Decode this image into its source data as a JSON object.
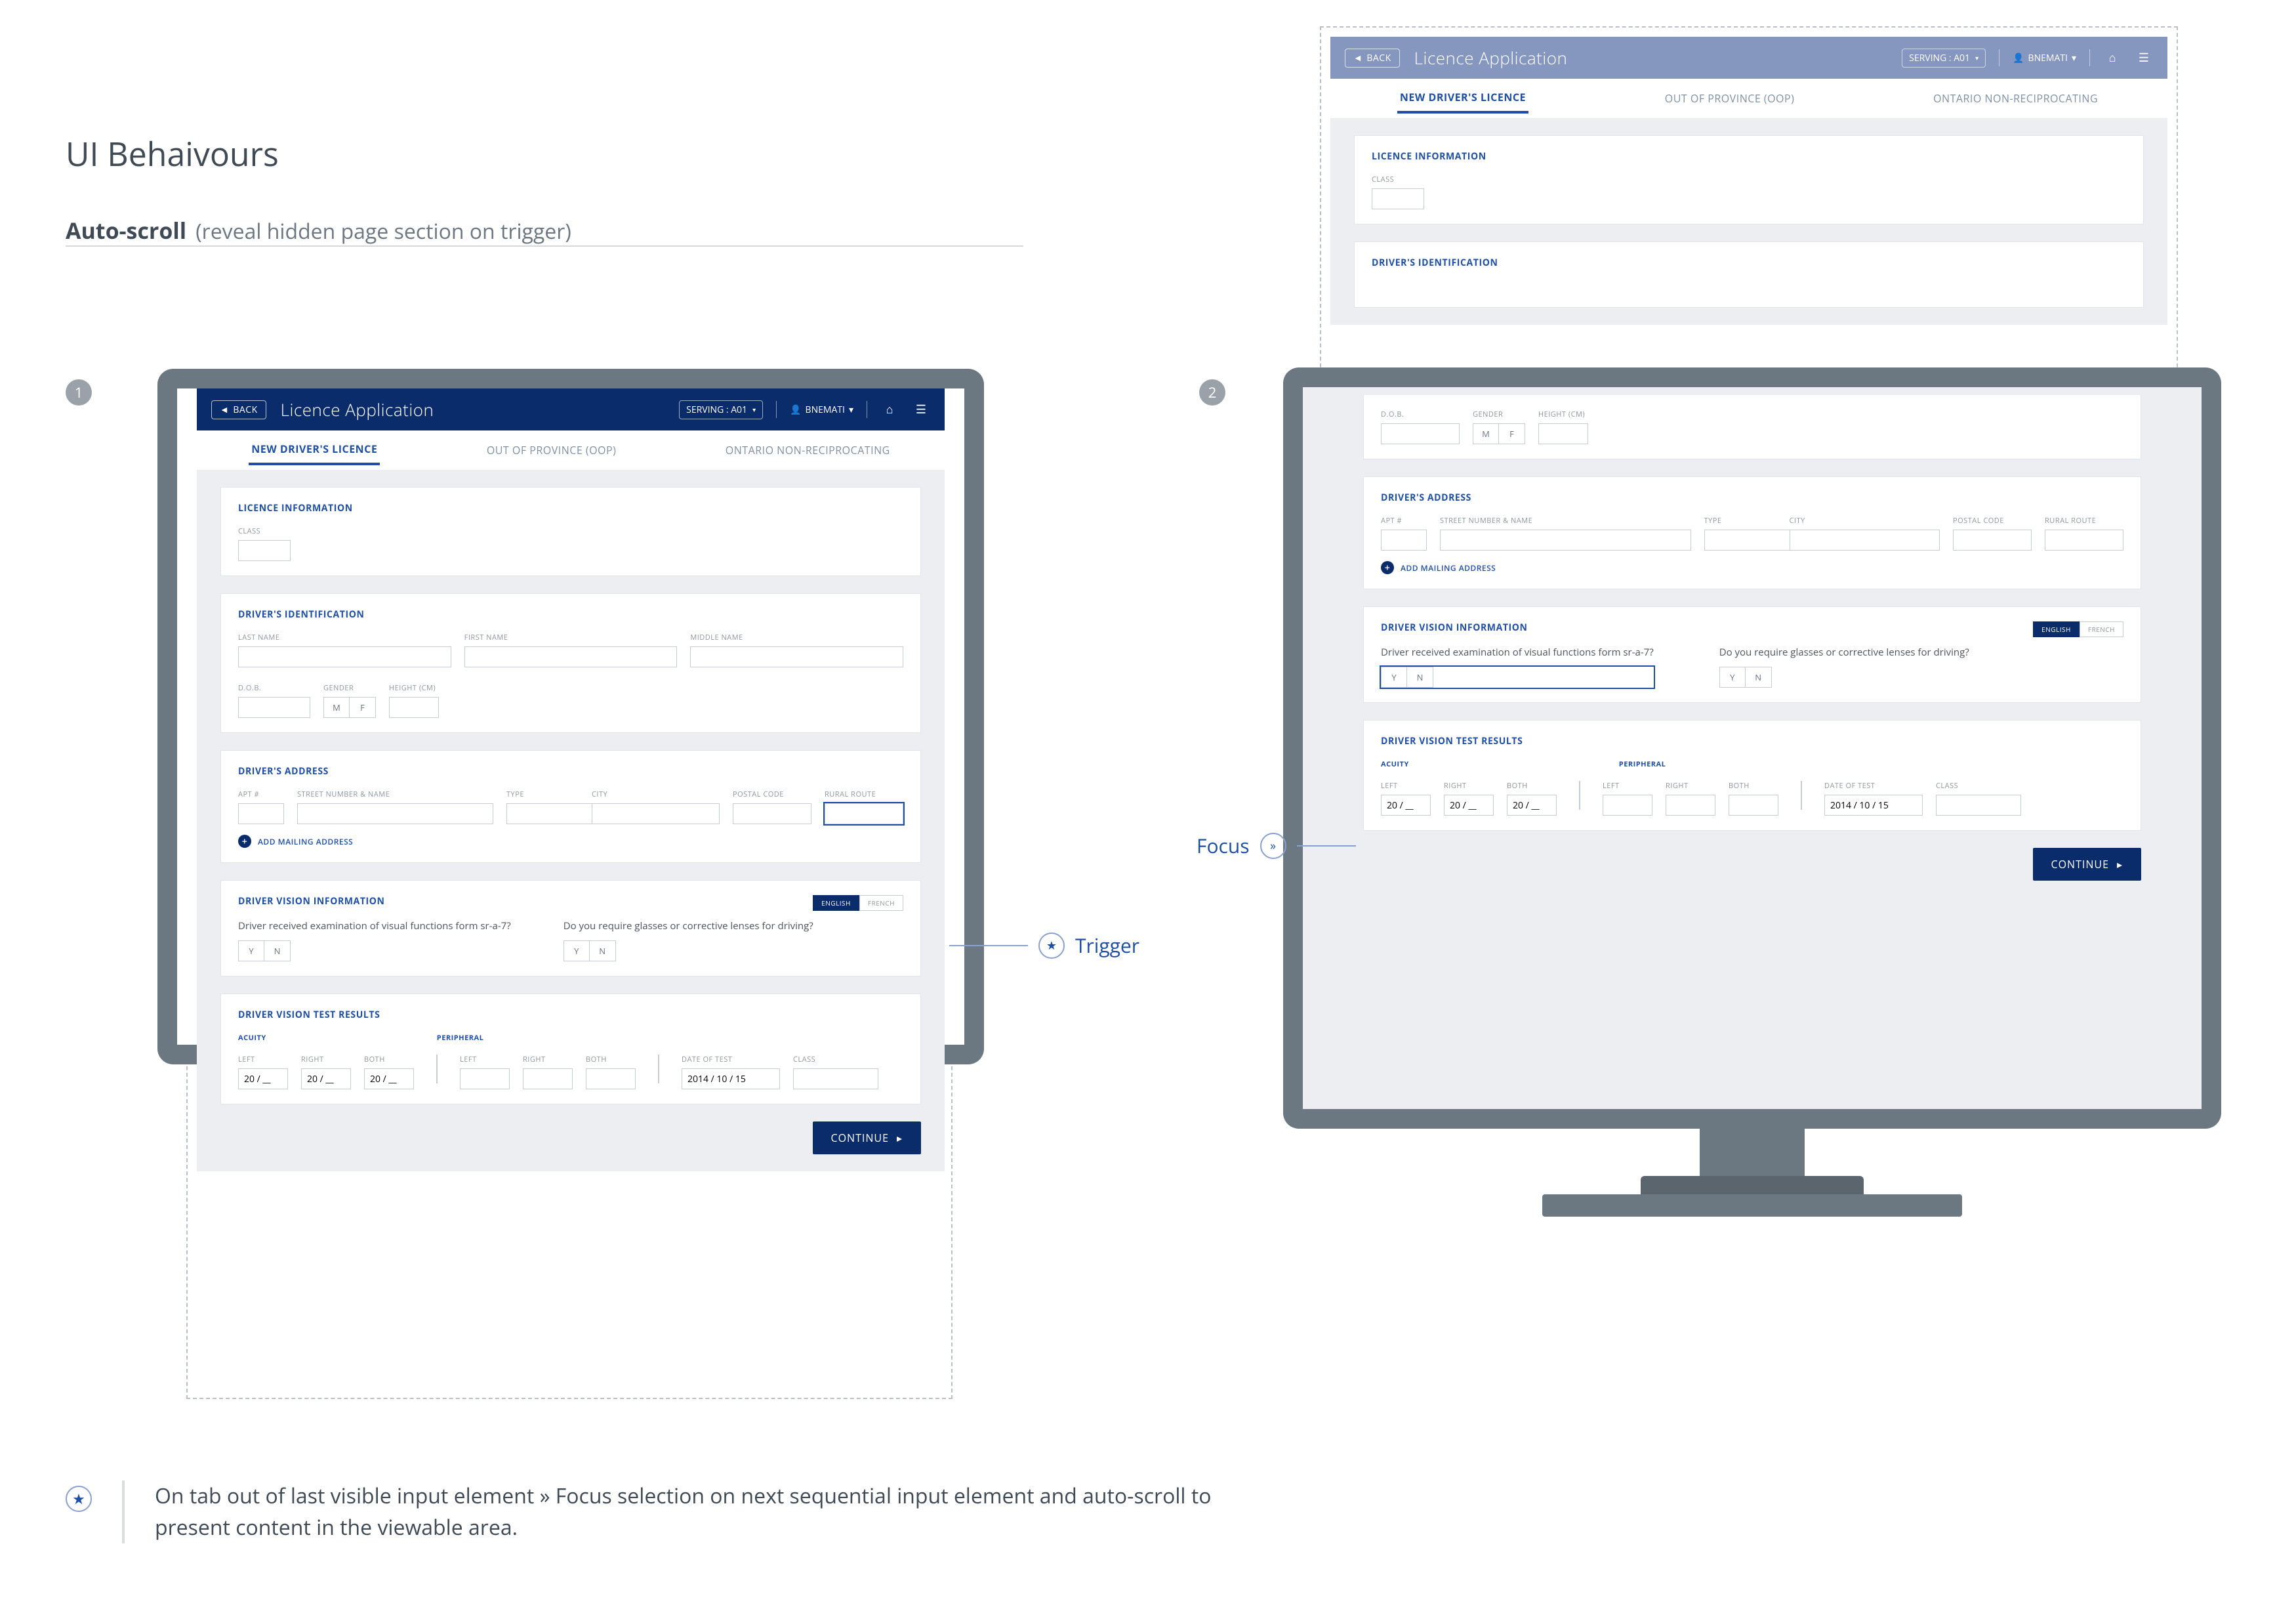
{
  "doc": {
    "title": "UI Behaivours",
    "subtitle_b": "Auto-scroll",
    "subtitle": "(reveal hidden page section on trigger)",
    "step1": "1",
    "step2": "2",
    "trigger_label": "Trigger",
    "focus_label": "Focus",
    "footnote": "On tab out of last visible input element » Focus selection on next sequential input element and auto-scroll to present content in the viewable area.",
    "star": "★",
    "chev": "»"
  },
  "app": {
    "back": "BACK",
    "back_arrow": "◄",
    "title": "Licence Application",
    "serving": "SERVING : A01",
    "user": "BNEMATI",
    "home": "⌂",
    "menu": "☰",
    "drop": "▾",
    "tabs": {
      "a": "NEW DRIVER'S LICENCE",
      "b": "OUT OF PROVINCE (OOP)",
      "c": "ONTARIO NON-RECIPROCATING"
    }
  },
  "licence_info": {
    "heading": "LICENCE INFORMATION",
    "class": "CLASS"
  },
  "ident": {
    "heading": "DRIVER'S IDENTIFICATION",
    "last": "LAST NAME",
    "first": "FIRST NAME",
    "middle": "MIDDLE NAME",
    "dob": "D.O.B.",
    "gender": "GENDER",
    "gender_m": "M",
    "gender_f": "F",
    "height": "HEIGHT (CM)"
  },
  "addr": {
    "heading": "DRIVER'S ADDRESS",
    "apt": "APT #",
    "street": "STREET NUMBER & NAME",
    "type": "TYPE",
    "city": "CITY",
    "postal": "POSTAL CODE",
    "rural": "RURAL ROUTE",
    "add": "ADD MAILING ADDRESS"
  },
  "vision": {
    "heading": "DRIVER VISION INFORMATION",
    "lang_en": "ENGLISH",
    "lang_fr": "FRENCH",
    "q1": "Driver received examination of visual functions form sr-a-7?",
    "q2": "Do you require glasses or corrective lenses for driving?",
    "y": "Y",
    "n": "N"
  },
  "results": {
    "heading": "DRIVER VISION TEST RESULTS",
    "acuity": "ACUITY",
    "periph": "PERIPHERAL",
    "left": "LEFT",
    "right": "RIGHT",
    "both": "BOTH",
    "date": "DATE OF TEST",
    "class": "CLASS",
    "frac": "20 / __",
    "date_v": "2014 / 10 / 15"
  },
  "continue": "CONTINUE",
  "cont_arrow": "▸"
}
